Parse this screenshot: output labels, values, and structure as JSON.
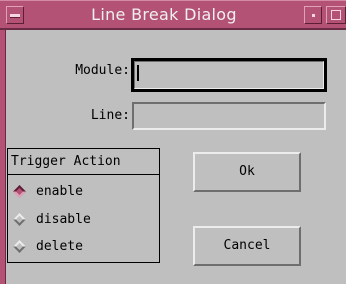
{
  "window": {
    "title": "Line Break Dialog"
  },
  "form": {
    "module_label": "Module:",
    "module_value": "",
    "line_label": "Line:",
    "line_value": ""
  },
  "trigger_group": {
    "title": "Trigger Action",
    "options": [
      {
        "label": "enable",
        "selected": true
      },
      {
        "label": "disable",
        "selected": false
      },
      {
        "label": "delete",
        "selected": false
      }
    ]
  },
  "buttons": {
    "ok_label": "Ok",
    "cancel_label": "Cancel"
  },
  "colors": {
    "titlebar": "#b35274",
    "background": "#bfbfbf"
  },
  "icons": {
    "window_menu": "window-menu-icon",
    "minimize": "minimize-icon",
    "maximize": "maximize-icon"
  }
}
